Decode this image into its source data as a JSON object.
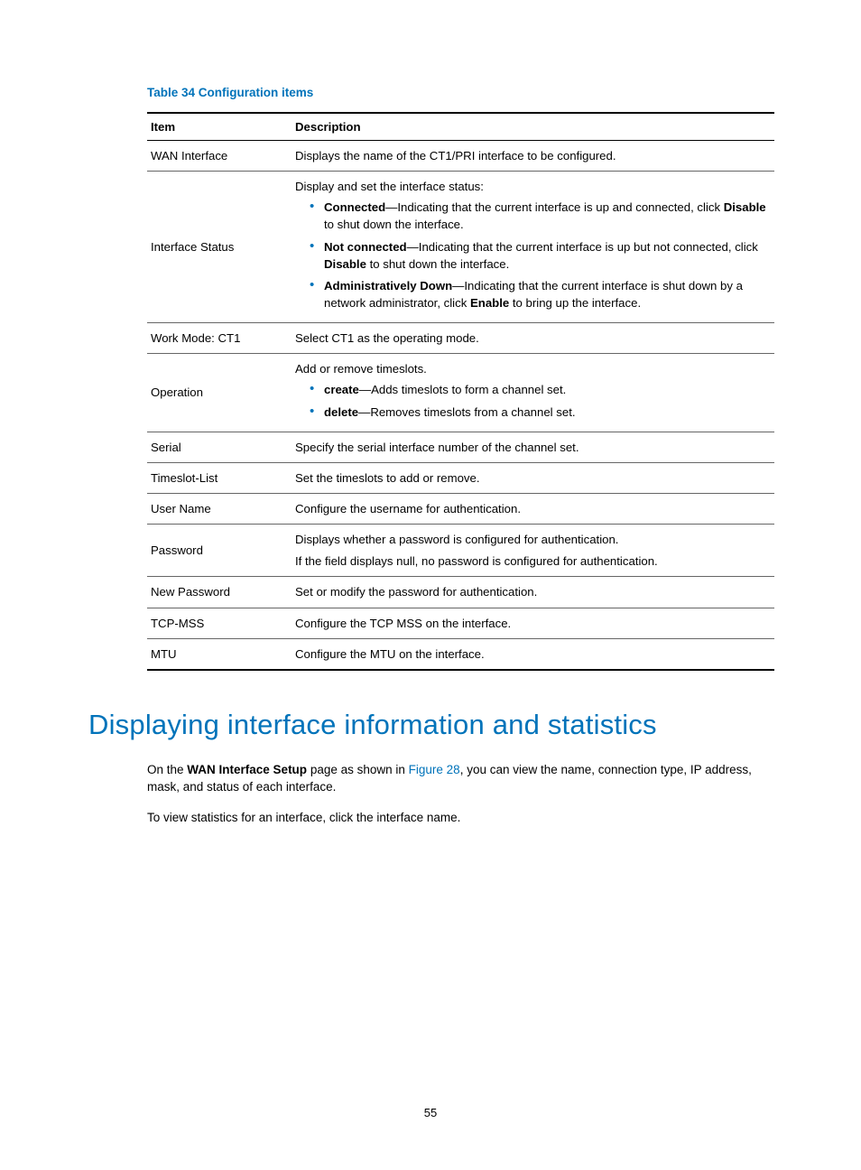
{
  "caption": "Table 34 Configuration items",
  "headers": {
    "item": "Item",
    "desc": "Description"
  },
  "rows": {
    "wan": {
      "item": "WAN Interface",
      "desc": "Displays the name of the CT1/PRI interface to be configured."
    },
    "status": {
      "item": "Interface Status",
      "intro": "Display and set the interface status:",
      "b1a": "Connected",
      "b1b": "—Indicating that the current interface is up and connected, click ",
      "b1c": "Disable",
      "b1d": " to shut down the interface.",
      "b2a": "Not connected",
      "b2b": "—Indicating that the current interface is up but not connected, click ",
      "b2c": "Disable",
      "b2d": " to shut down the interface.",
      "b3a": "Administratively Down",
      "b3b": "—Indicating that the current interface is shut down by a network administrator, click ",
      "b3c": "Enable",
      "b3d": " to bring up the interface."
    },
    "workmode": {
      "item": "Work Mode: CT1",
      "desc": "Select CT1 as the operating mode."
    },
    "operation": {
      "item": "Operation",
      "intro": "Add or remove timeslots.",
      "c1a": "create",
      "c1b": "—Adds timeslots to form a channel set.",
      "d1a": "delete",
      "d1b": "—Removes timeslots from a channel set."
    },
    "serial": {
      "item": "Serial",
      "desc": "Specify the serial interface number of the channel set."
    },
    "timeslot": {
      "item": "Timeslot-List",
      "desc": "Set the timeslots to add or remove."
    },
    "username": {
      "item": "User Name",
      "desc": "Configure the username for authentication."
    },
    "password": {
      "item": "Password",
      "l1": "Displays whether a password is configured for authentication.",
      "l2": "If the field displays null, no password is configured for authentication."
    },
    "newpass": {
      "item": "New Password",
      "desc": "Set or modify the password for authentication."
    },
    "tcpmss": {
      "item": "TCP-MSS",
      "desc": "Configure the TCP MSS on the interface."
    },
    "mtu": {
      "item": "MTU",
      "desc": "Configure the MTU on the interface."
    }
  },
  "section_heading": "Displaying interface information and statistics",
  "para1": {
    "a": "On the ",
    "b": "WAN Interface Setup",
    "c": " page as shown in ",
    "d": "Figure 28",
    "e": ", you can view the name, connection type, IP address, mask, and status of each interface."
  },
  "para2": "To view statistics for an interface, click the interface name.",
  "pagenum": "55"
}
